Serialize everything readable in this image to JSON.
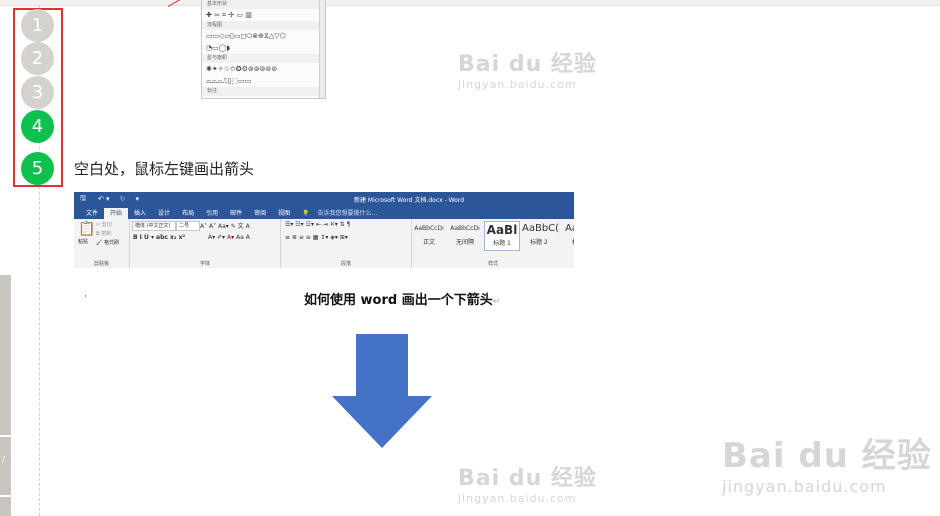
{
  "steps": {
    "items": [
      {
        "number": "1",
        "state": "done"
      },
      {
        "number": "2",
        "state": "done"
      },
      {
        "number": "3",
        "state": "done"
      },
      {
        "number": "4",
        "state": "active"
      },
      {
        "number": "5",
        "state": "active"
      }
    ],
    "active_color": "#0ec14f",
    "done_color": "#d4d2cd",
    "highlight_border": "#e03030"
  },
  "shape_menu": {
    "sections": [
      "基本形状",
      "流程图",
      "星与旗帜",
      "标注"
    ]
  },
  "step_text": "空白处，鼠标左键画出箭头",
  "word": {
    "window_title": "新建 Microsoft Word 文档.docx - Word",
    "tabs": [
      "文件",
      "开始",
      "插入",
      "设计",
      "布局",
      "引用",
      "邮件",
      "审阅",
      "视图"
    ],
    "active_tab": "开始",
    "tell_me": "告诉我您想要做什么...",
    "groups": [
      "剪贴板",
      "字体",
      "段落",
      "样式"
    ],
    "paste_label": "粘贴",
    "clipboard_items": [
      "剪切",
      "复制",
      "格式刷"
    ],
    "font_name": "楷体 (中文正文)",
    "font_size": "二号",
    "styles": [
      {
        "preview": "AaBbCcDı",
        "name": "正文"
      },
      {
        "preview": "AaBbCcDı",
        "name": "无间隔"
      },
      {
        "preview": "AaBl",
        "name": "标题 1"
      },
      {
        "preview": "AaBbC(",
        "name": "标题 2"
      },
      {
        "preview": "AaB",
        "name": "标"
      }
    ],
    "accent_color": "#2b579a"
  },
  "document": {
    "bullet": "·",
    "title": "如何使用 word 画出一个下箭头",
    "paragraph_mark": "↵",
    "arrow_color": "#4472c4"
  },
  "watermarks": [
    {
      "brand": "Bai du 经验",
      "url": "jingyan.baidu.com"
    },
    {
      "brand": "Bai du 经验",
      "url": "jingyan.baidu.com"
    },
    {
      "brand": "Bai du 经验",
      "url": "jingyan.baidu.com"
    }
  ]
}
